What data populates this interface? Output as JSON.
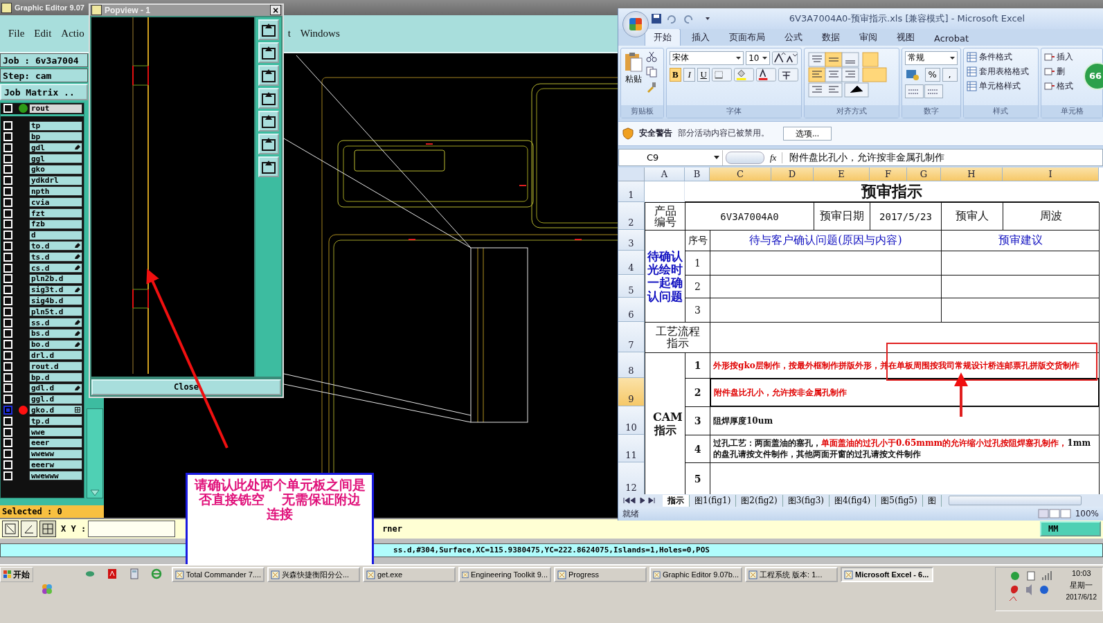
{
  "editor": {
    "title": "Graphic Editor 9.07",
    "menu": [
      {
        "label": "File"
      },
      {
        "label": "Edit"
      },
      {
        "label": "Actio"
      }
    ],
    "menu_continued": [
      {
        "label": "t"
      },
      {
        "label": "Windows"
      }
    ],
    "job": "Job : 6v3a7004",
    "step": "Step: cam",
    "matrix_button": "Job Matrix ..",
    "layers": [
      {
        "name": "rout",
        "current": true,
        "selected": false,
        "marked": false,
        "boxed": false,
        "color": "#2e9a18"
      },
      {
        "name": "tp",
        "current": false,
        "selected": false,
        "marked": false,
        "boxed": false
      },
      {
        "name": "bp",
        "current": false,
        "selected": false,
        "marked": false,
        "boxed": false
      },
      {
        "name": "gdl",
        "current": false,
        "selected": false,
        "marked": true,
        "boxed": false
      },
      {
        "name": "ggl",
        "current": false,
        "selected": false,
        "marked": false,
        "boxed": false
      },
      {
        "name": "gko",
        "current": false,
        "selected": false,
        "marked": false,
        "boxed": false
      },
      {
        "name": "ydkdrl",
        "current": false,
        "selected": false,
        "marked": false,
        "boxed": false
      },
      {
        "name": "npth",
        "current": false,
        "selected": false,
        "marked": false,
        "boxed": false
      },
      {
        "name": "cvia",
        "current": false,
        "selected": false,
        "marked": false,
        "boxed": false
      },
      {
        "name": "fzt",
        "current": false,
        "selected": false,
        "marked": false,
        "boxed": false
      },
      {
        "name": "fzb",
        "current": false,
        "selected": false,
        "marked": false,
        "boxed": false
      },
      {
        "name": "d",
        "current": false,
        "selected": false,
        "marked": false,
        "boxed": false
      },
      {
        "name": "to.d",
        "current": false,
        "selected": false,
        "marked": true,
        "boxed": false
      },
      {
        "name": "ts.d",
        "current": false,
        "selected": false,
        "marked": true,
        "boxed": false
      },
      {
        "name": "cs.d",
        "current": false,
        "selected": false,
        "marked": true,
        "boxed": false
      },
      {
        "name": "pln2b.d",
        "current": false,
        "selected": false,
        "marked": false,
        "boxed": false
      },
      {
        "name": "sig3t.d",
        "current": false,
        "selected": false,
        "marked": true,
        "boxed": false
      },
      {
        "name": "sig4b.d",
        "current": false,
        "selected": false,
        "marked": false,
        "boxed": false
      },
      {
        "name": "pln5t.d",
        "current": false,
        "selected": false,
        "marked": false,
        "boxed": false
      },
      {
        "name": "ss.d",
        "current": false,
        "selected": false,
        "marked": true,
        "boxed": false
      },
      {
        "name": "bs.d",
        "current": false,
        "selected": false,
        "marked": true,
        "boxed": false
      },
      {
        "name": "bo.d",
        "current": false,
        "selected": false,
        "marked": true,
        "boxed": false
      },
      {
        "name": "drl.d",
        "current": false,
        "selected": false,
        "marked": false,
        "boxed": false
      },
      {
        "name": "rout.d",
        "current": false,
        "selected": false,
        "marked": false,
        "boxed": false
      },
      {
        "name": "bp.d",
        "current": false,
        "selected": false,
        "marked": false,
        "boxed": false
      },
      {
        "name": "gdl.d",
        "current": false,
        "selected": false,
        "marked": true,
        "boxed": false
      },
      {
        "name": "ggl.d",
        "current": false,
        "selected": false,
        "marked": false,
        "boxed": false
      },
      {
        "name": "gko.d",
        "current": false,
        "selected": true,
        "marked": false,
        "boxed": true,
        "color": "#ff1010"
      },
      {
        "name": "tp.d",
        "current": false,
        "selected": false,
        "marked": false,
        "boxed": false
      },
      {
        "name": "wwe",
        "current": false,
        "selected": false,
        "marked": false,
        "boxed": false
      },
      {
        "name": "eeer",
        "current": false,
        "selected": false,
        "marked": false,
        "boxed": false
      },
      {
        "name": "wweww",
        "current": false,
        "selected": false,
        "marked": false,
        "boxed": false
      },
      {
        "name": "eeerw",
        "current": false,
        "selected": false,
        "marked": false,
        "boxed": false
      },
      {
        "name": "wwewww",
        "current": false,
        "selected": false,
        "marked": false,
        "boxed": false
      }
    ],
    "selected_count": "Selected : 0",
    "xy_label": "X Y :",
    "hint": "rner",
    "units_button": "MM",
    "status": "ss.d,#304,Surface,XC=115.9380475,YC=222.8624075,Islands=1,Holes=0,POS"
  },
  "popview": {
    "title": "Popview - 1",
    "close_x": "×",
    "close_button": "Close"
  },
  "note": {
    "text": "请确认此处两个单元板之间是否直接铣空　 无需保证附边连接"
  },
  "excel": {
    "title": "6V3A7004A0-预审指示.xls  [兼容模式] - Microsoft Excel",
    "tabs": [
      {
        "label": "开始",
        "selected": true
      },
      {
        "label": "插入",
        "selected": false
      },
      {
        "label": "页面布局",
        "selected": false
      },
      {
        "label": "公式",
        "selected": false
      },
      {
        "label": "数据",
        "selected": false
      },
      {
        "label": "审阅",
        "selected": false
      },
      {
        "label": "视图",
        "selected": false
      },
      {
        "label": "Acrobat",
        "selected": false
      }
    ],
    "ribbon": {
      "paste": "粘贴",
      "clipboard": "剪贴板",
      "font_name": "宋体",
      "font_size": "10",
      "bold": "B",
      "italic": "I",
      "underline": "U",
      "font": "字体",
      "alignment": "对齐方式",
      "number_format": "常规",
      "percent": "%",
      "comma": ",",
      "number": "数字",
      "style_items": [
        "条件格式",
        "套用表格格式",
        "单元格样式"
      ],
      "styles": "样式",
      "cell_items": [
        "插入",
        "删",
        "格式"
      ],
      "cells": "单元格",
      "badge": "66"
    },
    "security": {
      "title": "安全警告",
      "message": "部分活动内容已被禁用。",
      "button": "选项..."
    },
    "name_box": "C9",
    "fx": "fx",
    "formula": "附件盘比孔小，允许按非金属孔制作",
    "columns": [
      {
        "label": "A",
        "selected": false
      },
      {
        "label": "B",
        "selected": false
      },
      {
        "label": "C",
        "selected": true
      },
      {
        "label": "D",
        "selected": true
      },
      {
        "label": "E",
        "selected": true
      },
      {
        "label": "F",
        "selected": true
      },
      {
        "label": "G",
        "selected": true
      },
      {
        "label": "H",
        "selected": true
      },
      {
        "label": "I",
        "selected": true
      }
    ],
    "row_headers": [
      {
        "label": "1",
        "selected": false
      },
      {
        "label": "2",
        "selected": false
      },
      {
        "label": "3",
        "selected": false
      },
      {
        "label": "4",
        "selected": false
      },
      {
        "label": "5",
        "selected": false
      },
      {
        "label": "6",
        "selected": false
      },
      {
        "label": "7",
        "selected": false
      },
      {
        "label": "8",
        "selected": false
      },
      {
        "label": "9",
        "selected": true
      },
      {
        "label": "10",
        "selected": false
      },
      {
        "label": "11",
        "selected": false
      },
      {
        "label": "12",
        "selected": false
      }
    ],
    "sheet": {
      "title": "预审指示",
      "product_label": "产品编号",
      "product_code": "6V3A7004A0",
      "date_label": "预审日期",
      "date": "2017/5/23",
      "reviewer_label": "预审人",
      "reviewer": "周波",
      "confirm_label": "待确认光绘时一起确认问题",
      "seq_label": "序号",
      "issue_header": "待与客户确认问题(原因与内容)",
      "advice_header": "预审建议",
      "confirm_rows": [
        "1",
        "2",
        "3"
      ],
      "process_label": "工艺流程指示",
      "cam_label": "CAM指示",
      "cam_rows": [
        {
          "no": "1",
          "selected": false,
          "parts": [
            {
              "text": "外形按gko层制作，按最外框制作拼版外形，并在单板周围按我司常规设计桥连邮票孔拼版交货制作",
              "highlight": true
            }
          ]
        },
        {
          "no": "2",
          "selected": true,
          "parts": [
            {
              "text": "附件盘比孔小，允许按非金属孔制作",
              "highlight": true
            }
          ]
        },
        {
          "no": "3",
          "selected": false,
          "parts": [
            {
              "text": "阻焊厚度10um",
              "highlight": false
            }
          ]
        },
        {
          "no": "4",
          "selected": false,
          "parts": [
            {
              "text": "过孔工艺：两面盖油的塞孔，",
              "highlight": false
            },
            {
              "text": "单面盖油的过孔小于0.65mmm的允许缩小过孔按阻焊塞孔制作，",
              "highlight": true
            },
            {
              "text": "1mm的盘孔请按文件制作，其他两面开窗的过孔请按文件制作",
              "highlight": false
            }
          ]
        },
        {
          "no": "5",
          "selected": false,
          "parts": []
        }
      ]
    },
    "sheet_tabs": [
      {
        "label": "指示",
        "selected": true
      },
      {
        "label": "图1(fig1)",
        "selected": false
      },
      {
        "label": "图2(fig2)",
        "selected": false
      },
      {
        "label": "图3(fig3)",
        "selected": false
      },
      {
        "label": "图4(fig4)",
        "selected": false
      },
      {
        "label": "图5(fig5)",
        "selected": false
      },
      {
        "label": "图",
        "selected": false
      }
    ],
    "status": "就绪",
    "zoom": "100%"
  },
  "taskbar": {
    "start": "开始",
    "tasks": [
      {
        "label": "Total Commander 7....",
        "selected": false
      },
      {
        "label": "兴森快捷衡阳分公...",
        "selected": false
      },
      {
        "label": "get.exe",
        "selected": false
      },
      {
        "label": "Engineering Toolkit 9...",
        "selected": false
      },
      {
        "label": "Progress",
        "selected": false
      },
      {
        "label": "Graphic Editor 9.07b...",
        "selected": false
      },
      {
        "label": "工程系统  版本: 1...",
        "selected": false
      },
      {
        "label": "Microsoft Excel - 6...",
        "selected": true
      }
    ],
    "time": "10:03",
    "weekday": "星期一",
    "date": "2017/6/12"
  }
}
